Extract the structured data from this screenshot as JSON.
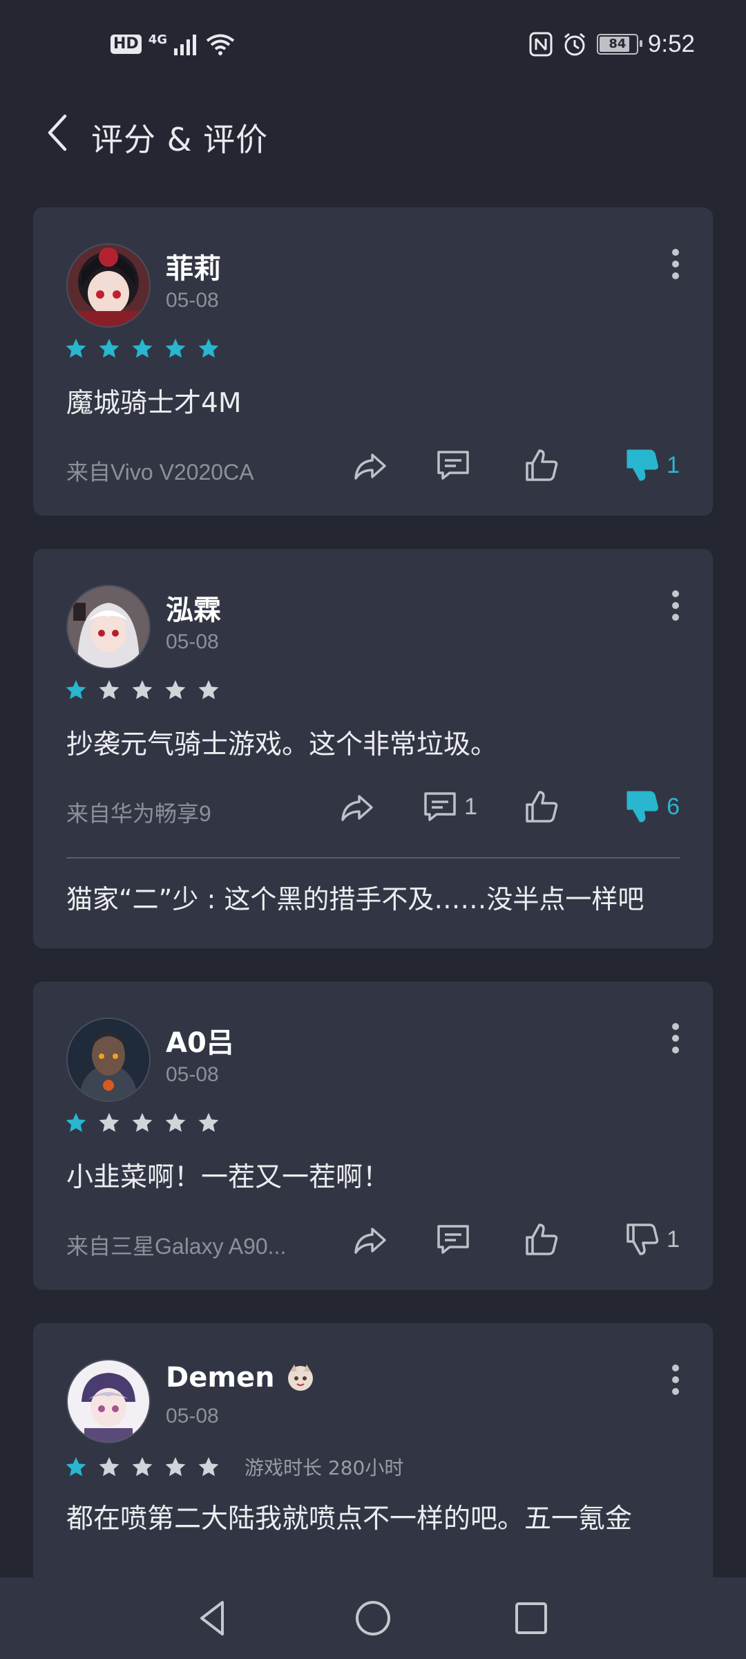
{
  "status_bar": {
    "hd": "HD",
    "network": "4G",
    "battery": "84",
    "battery_level": 0.84,
    "time": "9:52",
    "icons": [
      "signal-icon",
      "wifi-icon",
      "nfc-icon",
      "alarm-icon",
      "battery-icon"
    ]
  },
  "header": {
    "title": "评分 & 评价",
    "back_icon": "back-arrow-icon"
  },
  "colors": {
    "background": "#242731",
    "card": "#323644",
    "accent": "#29b6cf",
    "muted": "#8d909a"
  },
  "reviews": [
    {
      "username": "菲莉",
      "date": "05-08",
      "rating": 5,
      "text": "魔城骑士才4M",
      "device": "来自Vivo V2020CA",
      "comments": "",
      "likes": "",
      "dislikes": "1",
      "disliked": true
    },
    {
      "username": "泓霖",
      "date": "05-08",
      "rating": 1,
      "text": "抄袭元气骑士游戏。这个非常垃圾。",
      "device": "来自华为畅享9",
      "comments": "1",
      "likes": "",
      "dislikes": "6",
      "disliked": true,
      "reply": "猫家“二”少 : 这个黑的措手不及……没半点一样吧"
    },
    {
      "username": "A0吕",
      "date": "05-08",
      "rating": 1,
      "text": "小韭菜啊！一茬又一茬啊！",
      "device": "来自三星Galaxy A90...",
      "comments": "",
      "likes": "",
      "dislikes": "1",
      "disliked": false
    },
    {
      "username": "Demen",
      "date": "05-08",
      "rating": 1,
      "playtime": "游戏时长 280小时",
      "text": "都在喷第二大陆我就喷点不一样的吧。五一氪金"
    }
  ],
  "navbar": {
    "icons": [
      "back-triangle-icon",
      "home-circle-icon",
      "recents-square-icon"
    ]
  }
}
